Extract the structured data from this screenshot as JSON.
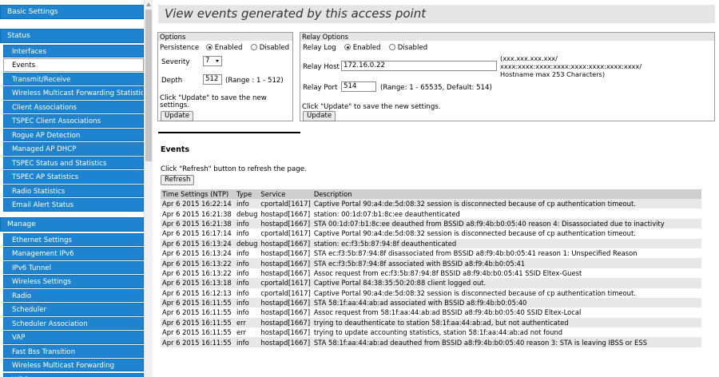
{
  "sidebar": {
    "top_items": [
      {
        "label": "Basic Settings",
        "kind": "head"
      }
    ],
    "status_head": "Status",
    "status_items": [
      {
        "label": "Interfaces",
        "active": false
      },
      {
        "label": "Events",
        "active": true
      },
      {
        "label": "Transmit/Receive",
        "active": false
      },
      {
        "label": "Wireless Multicast Forwarding Statistics",
        "active": false
      },
      {
        "label": "Client Associations",
        "active": false
      },
      {
        "label": "TSPEC Client Associations",
        "active": false
      },
      {
        "label": "Rogue AP Detection",
        "active": false
      },
      {
        "label": "Managed AP DHCP",
        "active": false
      },
      {
        "label": "TSPEC Status and Statistics",
        "active": false
      },
      {
        "label": "TSPEC AP Statistics",
        "active": false
      },
      {
        "label": "Radio Statistics",
        "active": false
      },
      {
        "label": "Email Alert Status",
        "active": false
      }
    ],
    "manage_head": "Manage",
    "manage_items": [
      {
        "label": "Ethernet Settings"
      },
      {
        "label": "Management IPv6"
      },
      {
        "label": "IPv6 Tunnel"
      },
      {
        "label": "Wireless Settings"
      },
      {
        "label": "Radio"
      },
      {
        "label": "Scheduler"
      },
      {
        "label": "Scheduler Association"
      },
      {
        "label": "VAP"
      },
      {
        "label": "Fast Bss Transition"
      },
      {
        "label": "Wireless Multicast Forwarding"
      },
      {
        "label": "WDS"
      }
    ]
  },
  "page": {
    "title": "View events generated by this access point"
  },
  "options": {
    "title": "Options",
    "persistence_label": "Persistence",
    "enabled_label": "Enabled",
    "disabled_label": "Disabled",
    "persistence_value": "Enabled",
    "severity_label": "Severity",
    "severity_value": "7",
    "depth_label": "Depth",
    "depth_value": "512",
    "depth_range": "(Range : 1 - 512)",
    "hint": "Click \"Update\" to save the new settings.",
    "update_button": "Update"
  },
  "relay": {
    "title": "Relay Options",
    "relay_log_label": "Relay Log",
    "enabled_label": "Enabled",
    "disabled_label": "Disabled",
    "relay_log_value": "Enabled",
    "relay_host_label": "Relay Host",
    "relay_host_value": "172.16.0.22",
    "host_format_line1": "(xxx.xxx.xxx.xxx/",
    "host_format_line2": "xxxx:xxxx:xxxx:xxxx:xxxx:xxxx:xxxx:xxxx/",
    "host_format_line3": "Hostname max 253 Characters)",
    "relay_port_label": "Relay Port",
    "relay_port_value": "514",
    "relay_port_range": "(Range: 1 - 65535, Default: 514)",
    "hint": "Click \"Update\" to save the new settings.",
    "update_button": "Update"
  },
  "events": {
    "heading": "Events",
    "hint": "Click \"Refresh\" button to refresh the page.",
    "refresh_button": "Refresh",
    "columns": [
      "Time Settings (NTP)",
      "Type",
      "Service",
      "Description"
    ],
    "rows": [
      [
        "Apr 6 2015 16:22:14",
        "info",
        "cportald[1617]",
        "Captive Portal 90:a4:de:5d:08:32 session is disconnected because of cp authentication timeout."
      ],
      [
        "Apr 6 2015 16:21:38",
        "debug",
        "hostapd[1667]",
        "station: 00:1d:07:b1:8c:ee deauthenticated"
      ],
      [
        "Apr 6 2015 16:21:38",
        "info",
        "hostapd[1667]",
        "STA 00:1d:07:b1:8c:ee deauthed from BSSID a8:f9:4b:b0:05:40 reason 4: Disassociated due to inactivity"
      ],
      [
        "Apr 6 2015 16:17:14",
        "info",
        "cportald[1617]",
        "Captive Portal 90:a4:de:5d:08:32 session is disconnected because of cp authentication timeout."
      ],
      [
        "Apr 6 2015 16:13:24",
        "debug",
        "hostapd[1667]",
        "station: ec:f3:5b:87:94:8f deauthenticated"
      ],
      [
        "Apr 6 2015 16:13:24",
        "info",
        "hostapd[1667]",
        "STA ec:f3:5b:87:94:8f disassociated from BSSID a8:f9:4b:b0:05:41 reason 1: Unspecified Reason"
      ],
      [
        "Apr 6 2015 16:13:22",
        "info",
        "hostapd[1667]",
        "STA ec:f3:5b:87:94:8f associated with BSSID a8:f9:4b:b0:05:41"
      ],
      [
        "Apr 6 2015 16:13:22",
        "info",
        "hostapd[1667]",
        "Assoc request from ec:f3:5b:87:94:8f BSSID a8:f9:4b:b0:05:41 SSID Eltex-Guest"
      ],
      [
        "Apr 6 2015 16:13:18",
        "info",
        "cportald[1617]",
        "Captive Portal 84:38:35:50:20:88 client logged out."
      ],
      [
        "Apr 6 2015 16:12:13",
        "info",
        "cportald[1617]",
        "Captive Portal 90:a4:de:5d:08:32 session is disconnected because of cp authentication timeout."
      ],
      [
        "Apr 6 2015 16:11:55",
        "info",
        "hostapd[1667]",
        "STA 58:1f:aa:44:ab:ad associated with BSSID a8:f9:4b:b0:05:40"
      ],
      [
        "Apr 6 2015 16:11:55",
        "info",
        "hostapd[1667]",
        "Assoc request from 58:1f:aa:44:ab:ad BSSID a8:f9:4b:b0:05:40 SSID Eltex-Local"
      ],
      [
        "Apr 6 2015 16:11:55",
        "err",
        "hostapd[1667]",
        "trying to deauthenticate to station 58:1f:aa:44:ab:ad, but not authenticated"
      ],
      [
        "Apr 6 2015 16:11:55",
        "err",
        "hostapd[1667]",
        "trying to update accounting statistics, station 58:1f:aa:44:ab:ad not found"
      ],
      [
        "Apr 6 2015 16:11:55",
        "info",
        "hostapd[1667]",
        "STA 58:1f:aa:44:ab:ad deauthed from BSSID a8:f9:4b:b0:05:40 reason 3: STA is leaving IBSS or ESS"
      ]
    ]
  }
}
